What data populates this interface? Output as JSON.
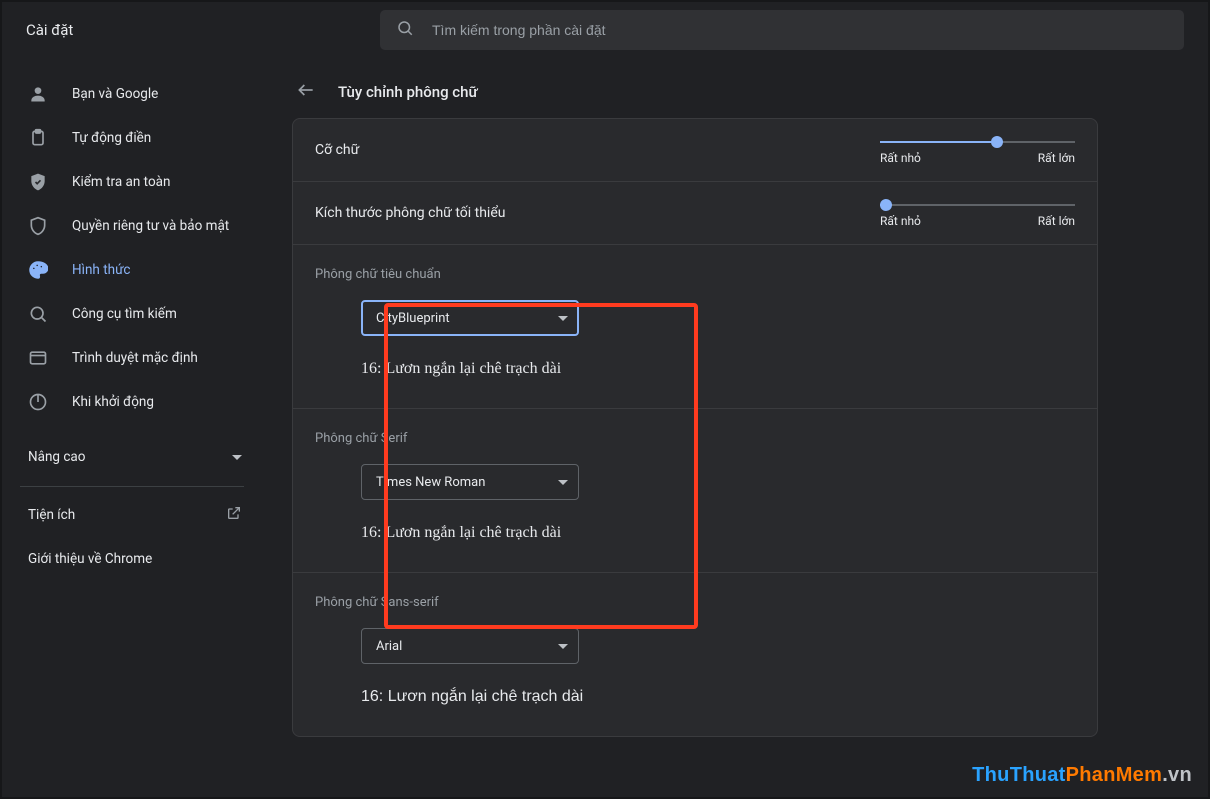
{
  "app_title": "Cài đặt",
  "search": {
    "placeholder": "Tìm kiếm trong phần cài đặt"
  },
  "sidebar": {
    "items": [
      {
        "label": "Bạn và Google"
      },
      {
        "label": "Tự động điền"
      },
      {
        "label": "Kiểm tra an toàn"
      },
      {
        "label": "Quyền riêng tư và bảo mật"
      },
      {
        "label": "Hình thức"
      },
      {
        "label": "Công cụ tìm kiếm"
      },
      {
        "label": "Trình duyệt mặc định"
      },
      {
        "label": "Khi khởi động"
      }
    ],
    "advanced": "Nâng cao",
    "extensions": "Tiện ích",
    "about": "Giới thiệu về Chrome"
  },
  "page": {
    "title": "Tùy chỉnh phông chữ",
    "font_size_label": "Cỡ chữ",
    "min_font_size_label": "Kích thước phông chữ tối thiểu",
    "slider": {
      "min_label": "Rất nhỏ",
      "max_label": "Rất lớn"
    },
    "slider_values": {
      "font_size_pct": 60,
      "min_font_size_pct": 3
    },
    "sample_text": "16: Lươn ngắn lại chê trạch dài",
    "fonts": {
      "standard": {
        "label": "Phông chữ tiêu chuẩn",
        "value": "CityBlueprint"
      },
      "serif": {
        "label": "Phông chữ Serif",
        "value": "Times New Roman"
      },
      "sans": {
        "label": "Phông chữ Sans-serif",
        "value": "Arial"
      }
    }
  },
  "watermark": {
    "part1": "ThuThuat",
    "part2": "PhanMem",
    "part3": ".vn"
  }
}
